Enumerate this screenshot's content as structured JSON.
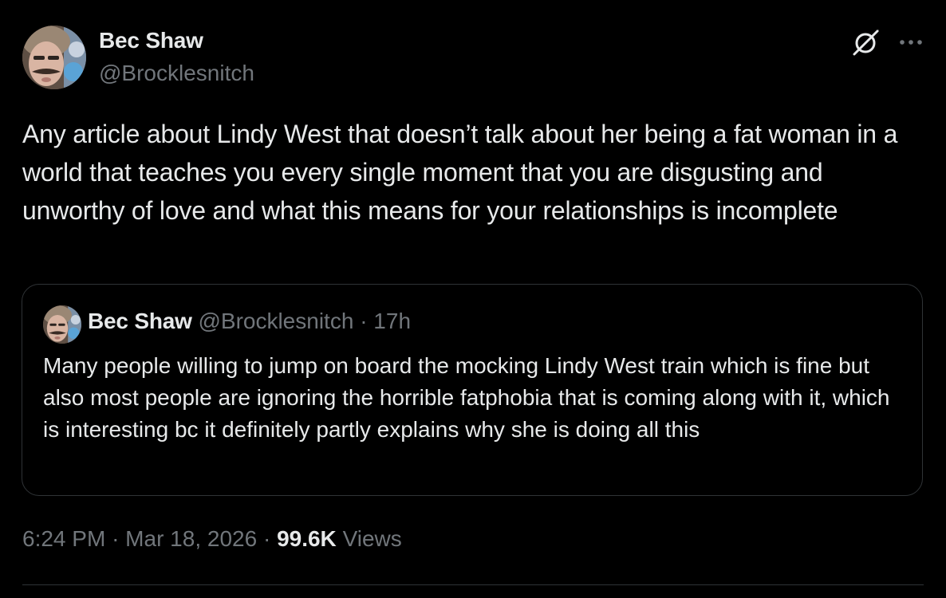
{
  "author": {
    "name": "Bec Shaw",
    "handle": "@Brocklesnitch"
  },
  "icons": {
    "grok": "grok-icon",
    "more": "more-options-icon"
  },
  "tweet": {
    "text": "Any article about Lindy West that doesn’t talk about her being a fat woman in a world that teaches you every single moment that you are disgusting and unworthy of love and what this means for your relationships is incomplete"
  },
  "quote": {
    "name": "Bec Shaw",
    "handle": "@Brocklesnitch",
    "separator": "·",
    "age": "17h",
    "text": "Many people willing to jump on board the mocking Lindy West train which is fine but also most people are ignoring the horrible fatphobia that is coming along with it, which is interesting bc it definitely partly explains why she is doing all this"
  },
  "meta": {
    "time": "6:24 PM",
    "separator": "·",
    "date": "Mar 18, 2026",
    "views_count": "99.6K",
    "views_label": "Views"
  },
  "colors": {
    "background": "#000000",
    "primary_text": "#e7e9ea",
    "secondary_text": "#71767b",
    "border": "#2f3336"
  }
}
